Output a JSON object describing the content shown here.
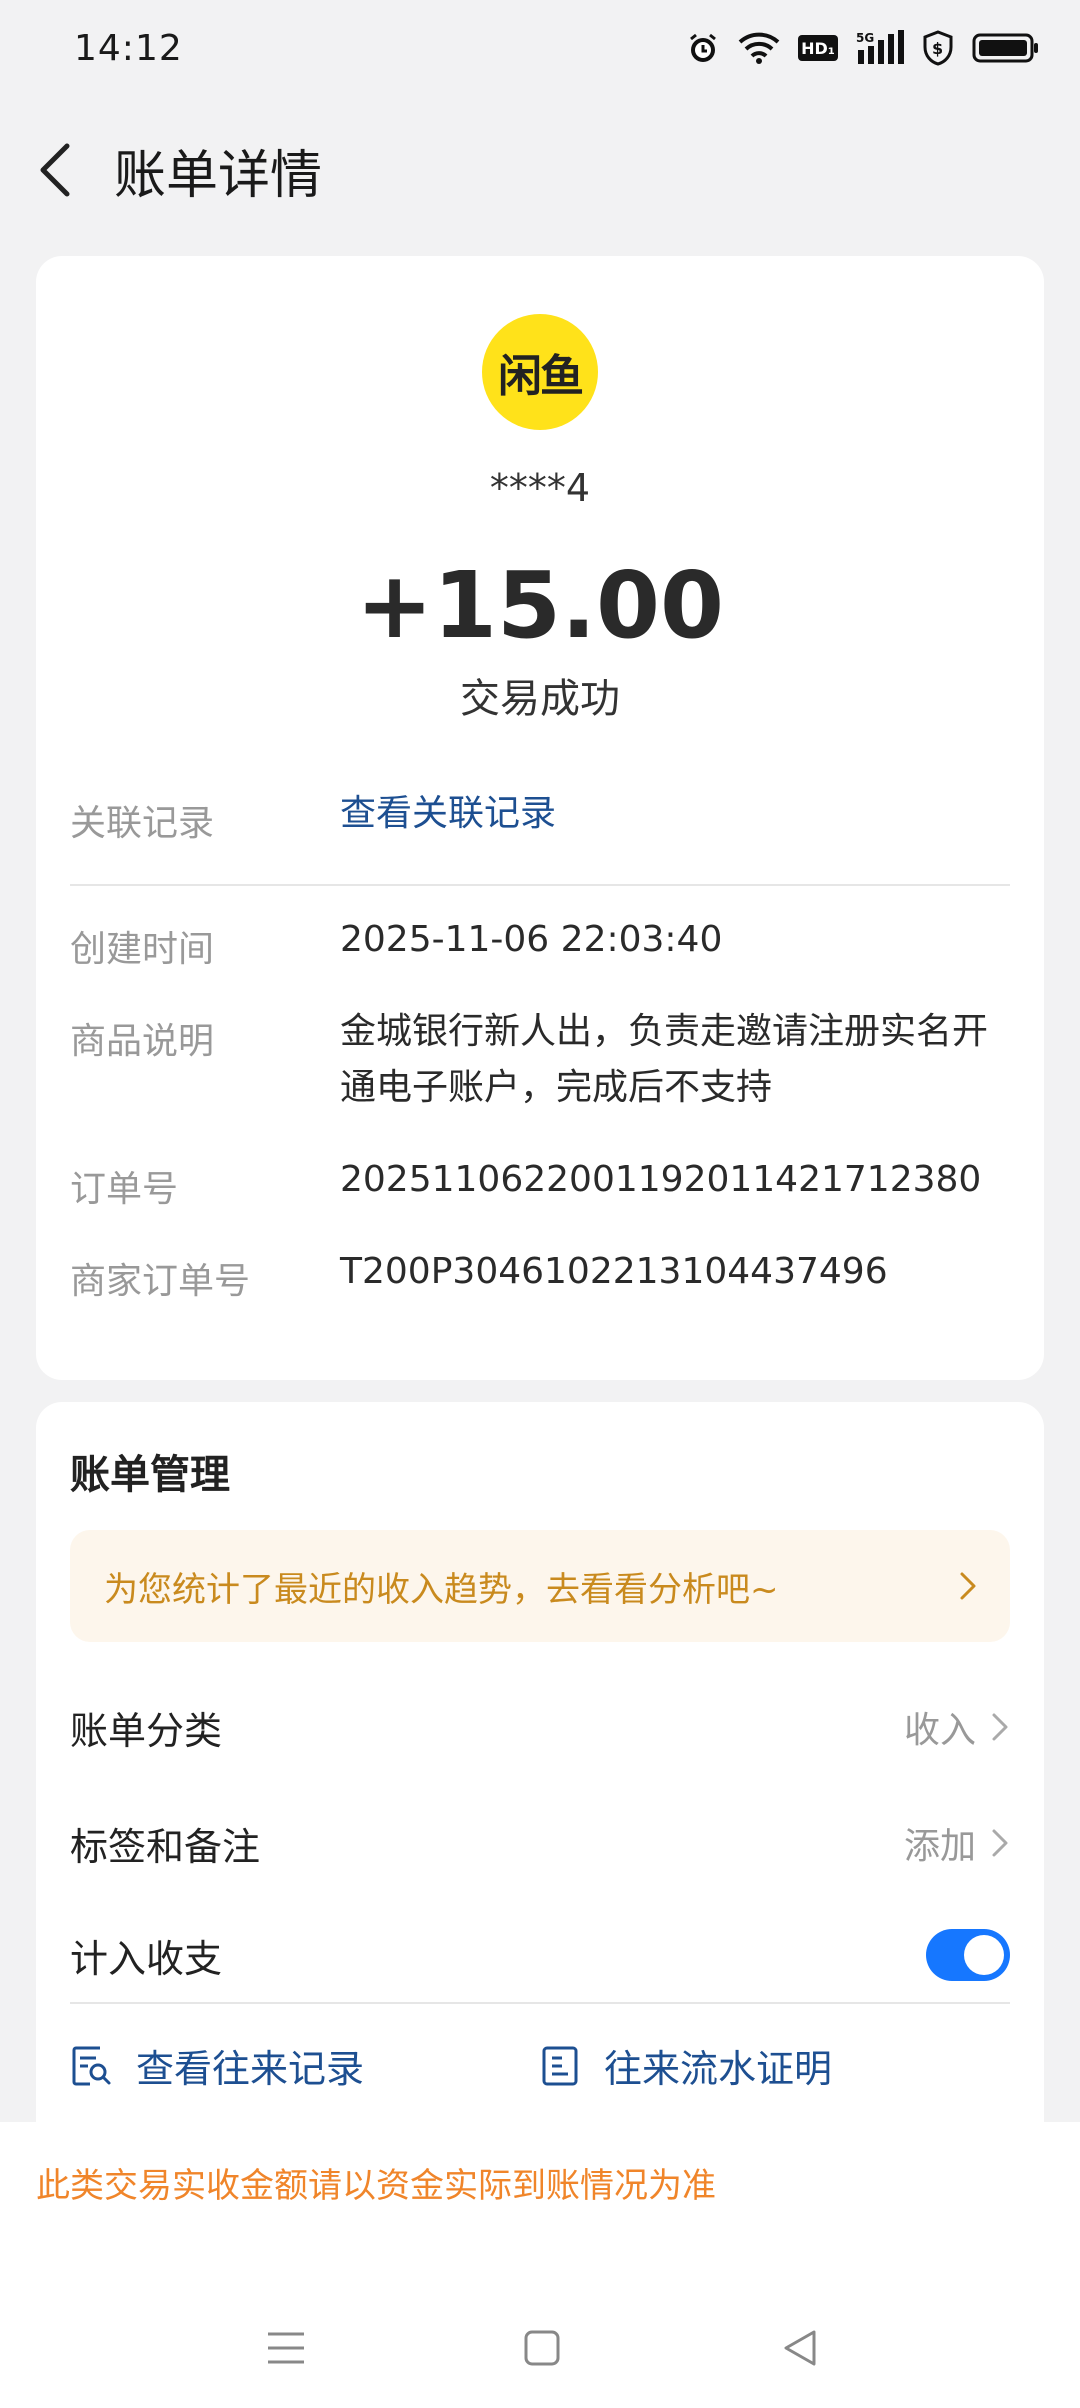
{
  "status_bar": {
    "time": "14:12",
    "icons": [
      "alarm-icon",
      "wifi-icon",
      "hd-icon",
      "signal-5g-icon",
      "shield-dollar-icon",
      "battery-icon"
    ],
    "hd_label": "HD₁",
    "network_label": "5G"
  },
  "header": {
    "title": "账单详情",
    "back_icon": "chevron-left-icon"
  },
  "transaction": {
    "merchant_logo_text": "闲鱼",
    "account": "****4",
    "amount": "+15.00",
    "status": "交易成功"
  },
  "details": {
    "related_label": "关联记录",
    "related_link": "查看关联记录",
    "rows": [
      {
        "label": "创建时间",
        "value": "2025-11-06 22:03:40"
      },
      {
        "label": "商品说明",
        "value": "金城银行新人出，负责走邀请注册实名开通电子账户，完成后不支持"
      },
      {
        "label": "订单号",
        "value": "2025110622001192011421712380"
      },
      {
        "label": "商家订单号",
        "value": "T200P3046102213104437496"
      }
    ]
  },
  "manage": {
    "title": "账单管理",
    "tip": "为您统计了最近的收入趋势，去看看分析吧~",
    "category_label": "账单分类",
    "category_value": "收入",
    "tags_label": "标签和备注",
    "tags_value": "添加",
    "include_label": "计入收支",
    "include_on": true,
    "records_link": "查看往来记录",
    "proof_link": "往来流水证明"
  },
  "footer": {
    "notice": "此类交易实收金额请以资金实际到账情况为准"
  },
  "colors": {
    "accent_link": "#1d4f91",
    "toggle_on": "#1677ff",
    "tip_text": "#c98a1e",
    "notice_text": "#f0852a",
    "logo_bg": "#ffe21a"
  }
}
